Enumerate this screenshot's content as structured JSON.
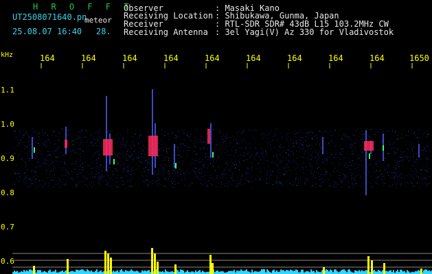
{
  "header": {
    "app_name": "H R O F F T",
    "file_name": "UT2508071640.pn",
    "file_type": "meteor",
    "datetime": "25.08.07 16:40",
    "trailing_value": "28."
  },
  "info": {
    "labels": [
      "Observer",
      "Receiving Location",
      "Receiver",
      "Receiving Antenna"
    ],
    "values": [
      ": Masaki Kano",
      ": Shibukawa, Gunma, Japan",
      ": RTL-SDR SDR# 43dB L15 103.2MHz CW",
      ": 3el Yagi(V) Az 330 for Vladivostok"
    ]
  },
  "axis": {
    "unit": "kHz",
    "x_ticks": [
      "164",
      "164",
      "164",
      "164",
      "164",
      "164",
      "164",
      "164",
      "164",
      "1650"
    ],
    "y_ticks": [
      "1.1",
      "1.0",
      "0.9",
      "0.8",
      "0.7",
      "0.6"
    ]
  },
  "colors": {
    "background": "#000000",
    "title_green": "#22c84a",
    "text_cyan": "#3ad2e8",
    "label_yellow": "#ffff00",
    "noise_blue": "#1a2d8a",
    "echo_red": "#ff2a5a",
    "echo_green": "#3cff6a"
  }
}
